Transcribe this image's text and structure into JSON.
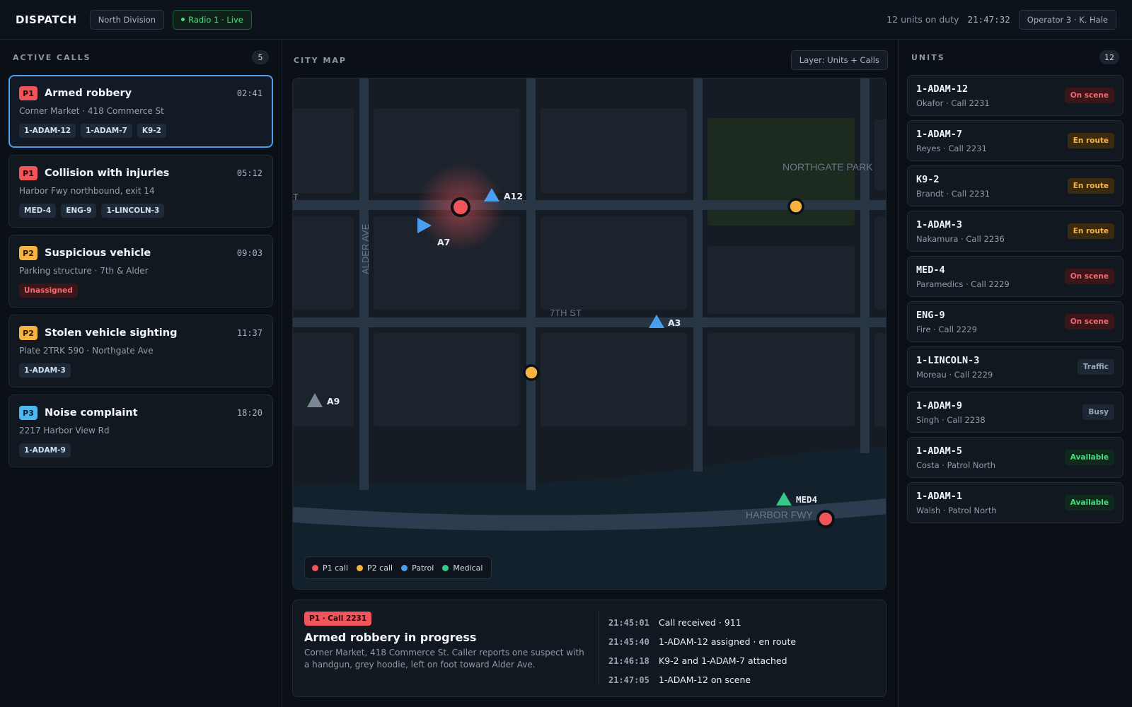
{
  "header": {
    "brand": "DISPATCH",
    "division": "North Division",
    "radio": "Radio 1 · Live",
    "units_on_duty": "12 units on duty",
    "clock": "21:47:32",
    "operator": "Operator 3 · K. Hale"
  },
  "calls_panel": {
    "title": "ACTIVE CALLS",
    "count": "5",
    "calls": [
      {
        "priority": "P1",
        "title": "Armed robbery",
        "time": "02:41",
        "address": "Corner Market · 418 Commerce St",
        "tags": [
          "1-ADAM-12",
          "1-ADAM-7",
          "K9-2"
        ],
        "selected": true
      },
      {
        "priority": "P1",
        "title": "Collision with injuries",
        "time": "05:12",
        "address": "Harbor Fwy northbound, exit 14",
        "tags": [
          "MED-4",
          "ENG-9",
          "1-LINCOLN-3"
        ]
      },
      {
        "priority": "P2",
        "title": "Suspicious vehicle",
        "time": "09:03",
        "address": "Parking structure · 7th & Alder",
        "unassigned": "Unassigned"
      },
      {
        "priority": "P2",
        "title": "Stolen vehicle sighting",
        "time": "11:37",
        "address": "Plate 2TRK 590 · Northgate Ave",
        "tags": [
          "1-ADAM-3"
        ]
      },
      {
        "priority": "P3",
        "title": "Noise complaint",
        "time": "18:20",
        "address": "2217 Harbor View Rd",
        "tags": [
          "1-ADAM-9"
        ]
      }
    ]
  },
  "map": {
    "title": "CITY MAP",
    "layer_button": "Layer: Units + Calls",
    "street_labels": {
      "alder": "ALDER AVE",
      "seventh": "7TH ST",
      "northgate": "NORTHGATE PARK",
      "harbor": "HARBOR FWY",
      "edge": "T"
    },
    "unit_labels": {
      "a12": "A12",
      "a7": "A7",
      "a3": "A3",
      "a9": "A9",
      "med4": "MED4"
    },
    "legend": {
      "p1": "P1 call",
      "p2": "P2 call",
      "patrol": "Patrol",
      "medical": "Medical"
    },
    "colors": {
      "p1": "#f0555b",
      "p2": "#f6b341",
      "patrol": "#4a9ef0",
      "medical": "#34c98a",
      "idle": "#7c8796"
    }
  },
  "detail": {
    "badge": "P1 · Call 2231",
    "title": "Armed robbery in progress",
    "description": "Corner Market, 418 Commerce St. Caller reports one suspect with a handgun, grey hoodie, left on foot toward Alder Ave.",
    "timeline": [
      {
        "time": "21:45:01",
        "text": "Call received · 911"
      },
      {
        "time": "21:45:40",
        "text": "1-ADAM-12 assigned · en route"
      },
      {
        "time": "21:46:18",
        "text": "K9-2 and 1-ADAM-7 attached"
      },
      {
        "time": "21:47:05",
        "text": "1-ADAM-12 on scene"
      }
    ]
  },
  "units_panel": {
    "title": "UNITS",
    "count": "12",
    "units": [
      {
        "id": "1-ADAM-12",
        "sub": "Okafor · Call 2231",
        "status": "On scene",
        "kind": "scene"
      },
      {
        "id": "1-ADAM-7",
        "sub": "Reyes · Call 2231",
        "status": "En route",
        "kind": "route"
      },
      {
        "id": "K9-2",
        "sub": "Brandt · Call 2231",
        "status": "En route",
        "kind": "route"
      },
      {
        "id": "1-ADAM-3",
        "sub": "Nakamura · Call 2236",
        "status": "En route",
        "kind": "route"
      },
      {
        "id": "MED-4",
        "sub": "Paramedics · Call 2229",
        "status": "On scene",
        "kind": "scene"
      },
      {
        "id": "ENG-9",
        "sub": "Fire · Call 2229",
        "status": "On scene",
        "kind": "scene"
      },
      {
        "id": "1-LINCOLN-3",
        "sub": "Moreau · Call 2229",
        "status": "Traffic",
        "kind": "traffic"
      },
      {
        "id": "1-ADAM-9",
        "sub": "Singh · Call 2238",
        "status": "Busy",
        "kind": "busy"
      },
      {
        "id": "1-ADAM-5",
        "sub": "Costa · Patrol North",
        "status": "Available",
        "kind": "avail"
      },
      {
        "id": "1-ADAM-1",
        "sub": "Walsh · Patrol North",
        "status": "Available",
        "kind": "avail"
      }
    ]
  }
}
